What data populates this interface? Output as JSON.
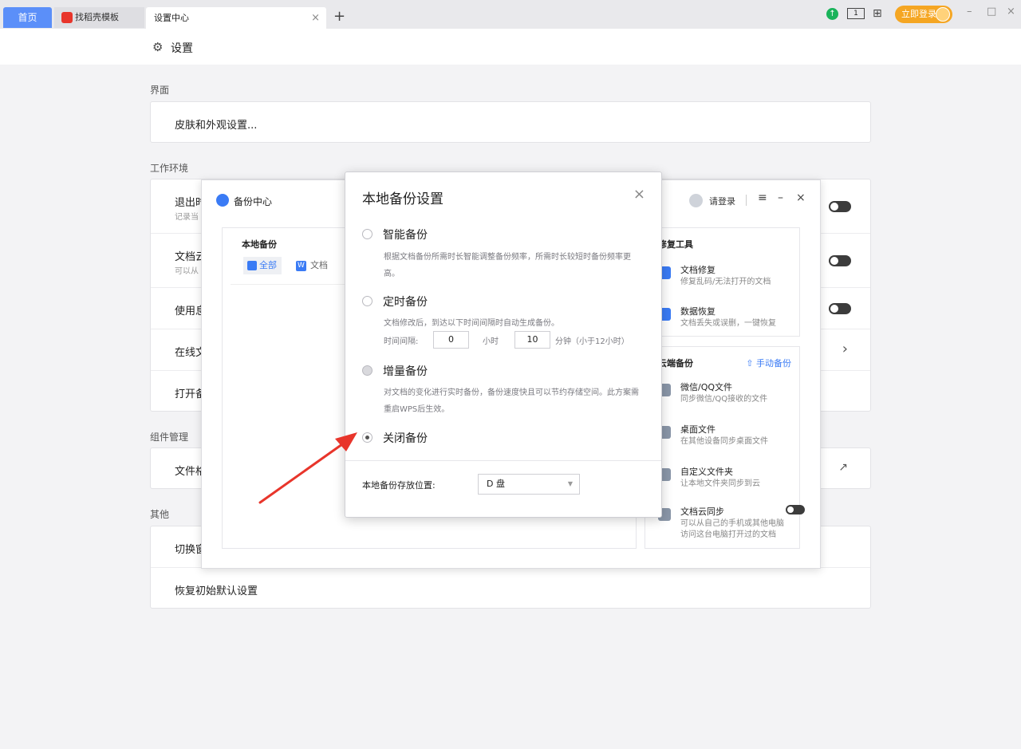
{
  "tabs": {
    "home": "首页",
    "draft": "找稻壳模板",
    "settings": "设置中心",
    "close": "×",
    "add": "+"
  },
  "topbar": {
    "layout_icon_text": "1",
    "login": "立即登录",
    "min": "–",
    "max": "□",
    "close": "×"
  },
  "header": {
    "title": "设置"
  },
  "sections": {
    "ui": "界面",
    "work": "工作环境",
    "component": "组件管理",
    "other": "其他"
  },
  "ui_rows": {
    "skin": "皮肤和外观设置..."
  },
  "work_rows": [
    {
      "label": "退出时",
      "sub": "记录当"
    },
    {
      "label": "文档云",
      "sub": "可以从"
    },
    {
      "label": "使用息",
      "sub": ""
    },
    {
      "label": "在线文",
      "sub": ""
    },
    {
      "label": "打开备",
      "sub": ""
    }
  ],
  "component_rows": {
    "file": "文件格"
  },
  "other_rows": {
    "switch": "切换窗",
    "restore": "恢复初始默认设置"
  },
  "backup_center": {
    "title": "备份中心",
    "login": "请登录",
    "local": {
      "header": "本地备份",
      "chip_all": "全部",
      "chip_doc": "文档"
    },
    "tools": {
      "header": "修复工具",
      "items": [
        {
          "title": "文档修复",
          "desc": "修复乱码/无法打开的文档"
        },
        {
          "title": "数据恢复",
          "desc": "文档丢失或误删，一键恢复"
        }
      ]
    },
    "cloud": {
      "header": "云端备份",
      "manual": "手动备份",
      "items": [
        {
          "title": "微信/QQ文件",
          "desc": "同步微信/QQ接收的文件"
        },
        {
          "title": "桌面文件",
          "desc": "在其他设备同步桌面文件"
        },
        {
          "title": "自定义文件夹",
          "desc": "让本地文件夹同步到云"
        },
        {
          "title": "文档云同步",
          "desc": "可以从自己的手机或其他电脑",
          "desc2": "访问这台电脑打开过的文档"
        }
      ]
    }
  },
  "dialog": {
    "title": "本地备份设置",
    "close": "×",
    "options": [
      {
        "name": "智能备份",
        "desc": "根据文档备份所需时长智能调整备份频率，所需时长较短时备份频率更高。",
        "selected": false
      },
      {
        "name": "定时备份",
        "desc": "文档修改后，到达以下时间间隔时自动生成备份。",
        "selected": false
      },
      {
        "name": "增量备份",
        "desc": "对文档的变化进行实时备份，备份速度快且可以节约存储空间。此方案需重启WPS后生效。",
        "selected": false
      },
      {
        "name": "关闭备份",
        "desc": "",
        "selected": true
      }
    ],
    "interval": {
      "label": "时间间隔:",
      "hours": "0",
      "hours_unit": "小时",
      "minutes": "10",
      "minutes_unit": "分钟（小于12小时）"
    },
    "location_label": "本地备份存放位置:",
    "location_value": "D 盘"
  },
  "colors": {
    "accent": "#3a7bf5",
    "brand_tab": "#5b8ff9",
    "login": "#f5a623",
    "arrow": "#e8352b"
  }
}
